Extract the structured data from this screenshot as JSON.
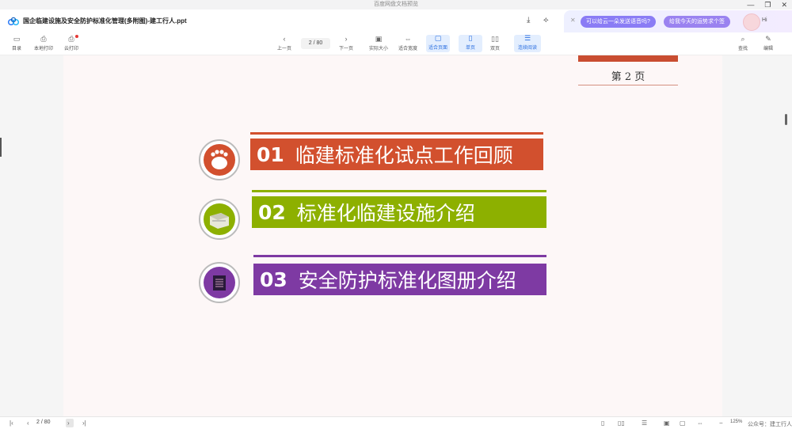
{
  "window": {
    "title": "百度网盘文档预览",
    "controls": [
      "—",
      "❐",
      "✕"
    ]
  },
  "document": {
    "name": "国企临建设施及安全防护标准化管理(多附图)-建工行人.ppt"
  },
  "ai": {
    "suggestion1": "可以给云一朵发送语音吗?",
    "suggestion2": "给我今天的运势求个签",
    "greeting": "Hi"
  },
  "toolbar": {
    "toc": "目录",
    "local_print": "本地打印",
    "cloud_print": "云打印",
    "prev": "上一页",
    "page_current": "2",
    "page_total": "80",
    "next": "下一页",
    "actual_size": "实际大小",
    "fit_width": "适合宽度",
    "fit_page": "适合页面",
    "single": "单页",
    "double": "双页",
    "continuous": "连续阅读",
    "search": "查找",
    "edit": "编辑"
  },
  "slide": {
    "page_label": "第 2 页",
    "items": [
      {
        "num": "01",
        "text": "临建标准化试点工作回顾"
      },
      {
        "num": "02",
        "text": "标准化临建设施介绍"
      },
      {
        "num": "03",
        "text": "安全防护标准化图册介绍"
      }
    ]
  },
  "statusbar": {
    "page_current": "2",
    "page_total": "80",
    "zoom": "125%",
    "watermark": "公众号：建工行人"
  },
  "colors": {
    "orange": "#d2502e",
    "green": "#8db000",
    "purple": "#7e3aa3",
    "accent": "#2b6fe0"
  }
}
